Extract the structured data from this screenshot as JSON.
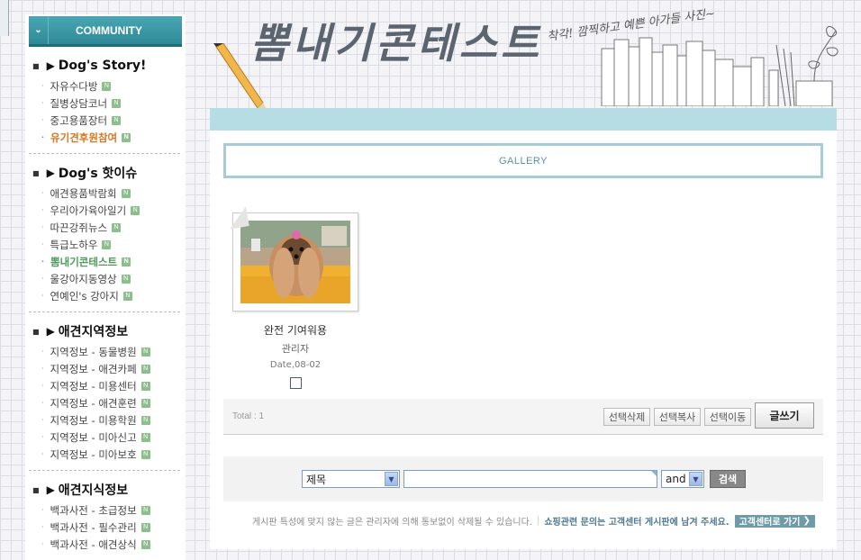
{
  "sidebar": {
    "header": "COMMUNITY",
    "sections": [
      {
        "title": "Dog's Story!",
        "items": [
          {
            "label": "자유수다방",
            "style": ""
          },
          {
            "label": "질병상담코너",
            "style": ""
          },
          {
            "label": "중고용품장터",
            "style": ""
          },
          {
            "label": "유기견후원참여",
            "style": "orange"
          }
        ]
      },
      {
        "title": "Dog's 핫이슈",
        "items": [
          {
            "label": "애견용품박람회",
            "style": ""
          },
          {
            "label": "우리아가육아일기",
            "style": ""
          },
          {
            "label": "따끈강쥐뉴스",
            "style": ""
          },
          {
            "label": "특급노하우",
            "style": ""
          },
          {
            "label": "뽐내기콘테스트",
            "style": "green"
          },
          {
            "label": "울강아지동영상",
            "style": ""
          },
          {
            "label": "연예인's 강아지",
            "style": ""
          }
        ]
      },
      {
        "title": "애견지역정보",
        "items": [
          {
            "label": "지역정보 - 동물병원",
            "style": ""
          },
          {
            "label": "지역정보 - 애견카페",
            "style": ""
          },
          {
            "label": "지역정보 - 미용센터",
            "style": ""
          },
          {
            "label": "지역정보 - 애견훈련",
            "style": ""
          },
          {
            "label": "지역정보 - 미용학원",
            "style": ""
          },
          {
            "label": "지역정보 - 미아신고",
            "style": ""
          },
          {
            "label": "지역정보 - 미아보호",
            "style": ""
          }
        ]
      },
      {
        "title": "애견지식정보",
        "items": [
          {
            "label": "백과사전 - 초급정보",
            "style": ""
          },
          {
            "label": "백과사전 - 필수관리",
            "style": ""
          },
          {
            "label": "백과사전 - 애견상식",
            "style": ""
          }
        ]
      }
    ],
    "new_badge": "N"
  },
  "banner": {
    "title": "뽐내기콘테스트",
    "subtitle": "착각! 깜찍하고 예쁜 아가들 사진~"
  },
  "board": {
    "name": "GALLERY",
    "post": {
      "title": "완전 기여워용",
      "author": "관리자",
      "date": "Date,08-02"
    },
    "total": "Total : 1",
    "buttons": {
      "delete": "선택삭제",
      "copy": "선택복사",
      "move": "선택이동",
      "write": "글쓰기"
    },
    "search": {
      "field_select": "제목",
      "operator_select": "and",
      "button": "검색"
    },
    "notice": {
      "text": "게시판 특성에 맞지 않는 글은 관리자에 의해 통보없이 삭제될 수 있습니다.",
      "shopping": "쇼핑관련 문의는 고객센터 게시판에 남겨 주세요.",
      "cs_button": "고객센터로 가기"
    }
  },
  "colors": {
    "accent_teal": "#2e8a96",
    "content_bar": "#b6dce4",
    "highlight_orange": "#d6771f",
    "highlight_green": "#4f9a5a"
  }
}
